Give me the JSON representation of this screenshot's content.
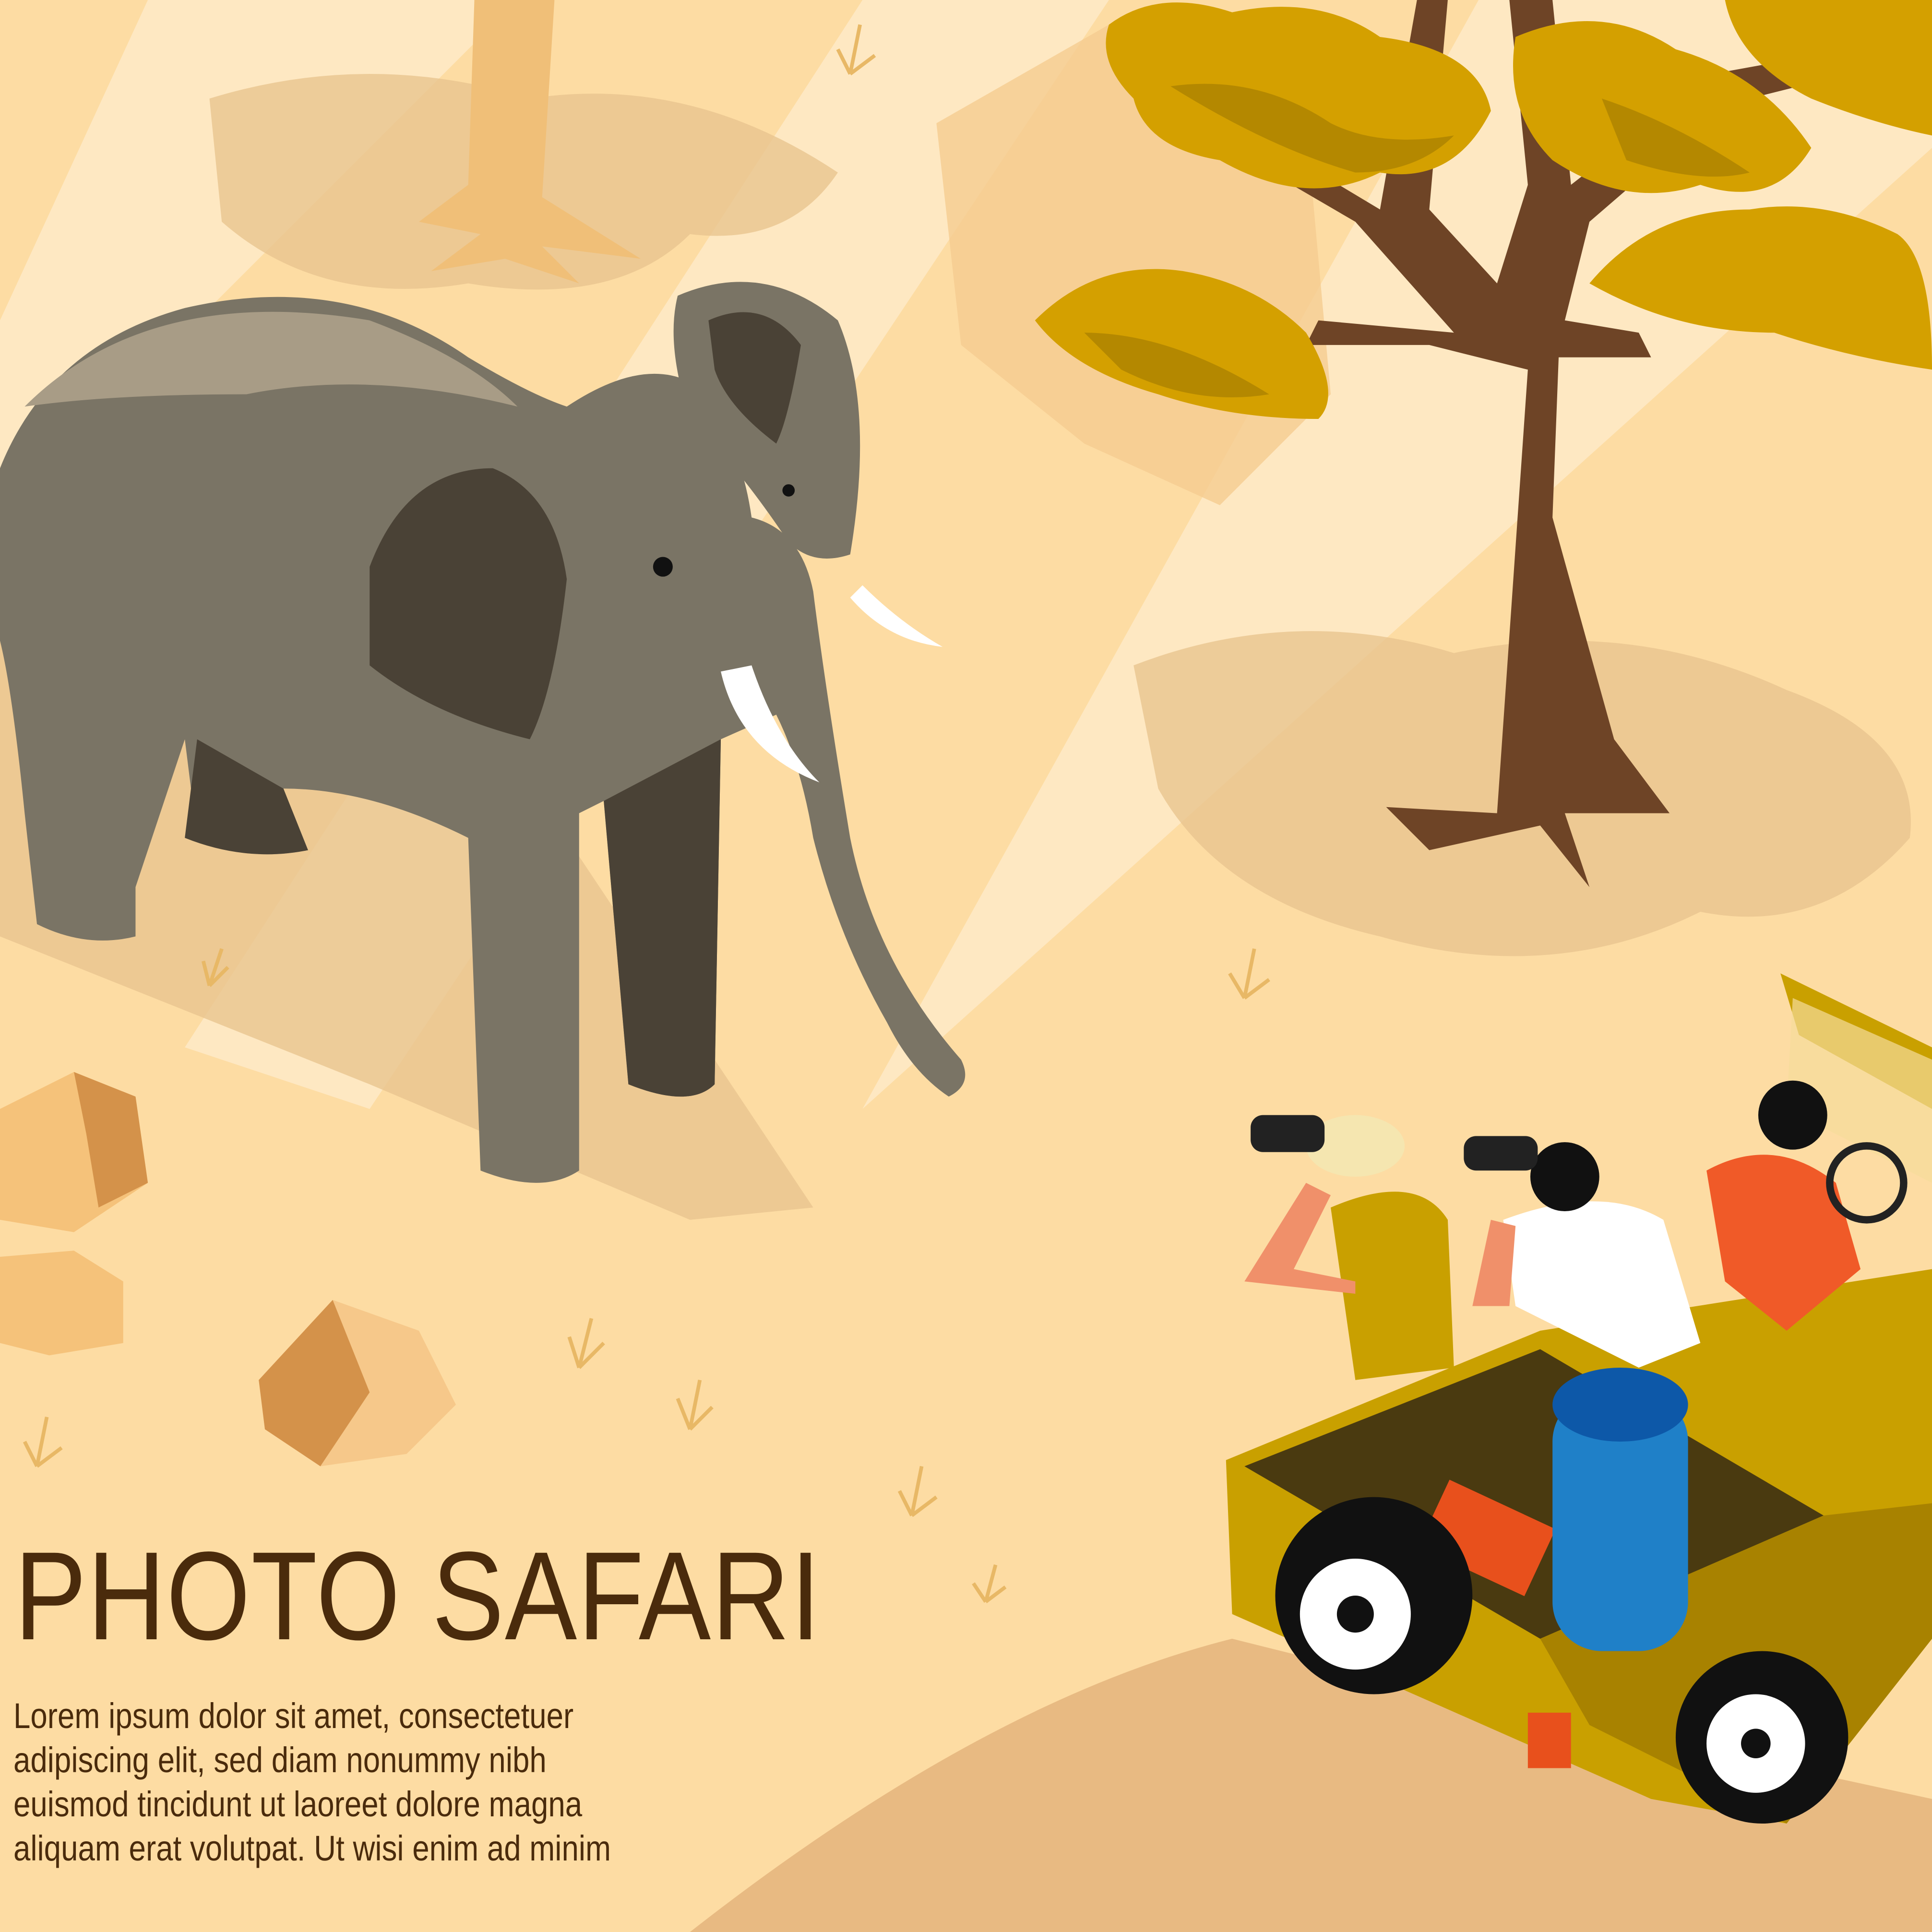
{
  "title": "PHOTO SAFARI",
  "body_lines": [
    "Lorem ipsum dolor sit amet, consectetuer",
    "adipiscing elit, sed diam nonummy nibh",
    "euismod tincidunt ut laoreet dolore magna",
    "aliquam erat volutpat. Ut wisi enim ad minim"
  ],
  "colors": {
    "background": "#fddca3",
    "text": "#4a2b0c",
    "elephant": "#7a7465",
    "tree_trunk": "#6e4426",
    "foliage": "#d4a000",
    "jeep": "#c9a000"
  }
}
